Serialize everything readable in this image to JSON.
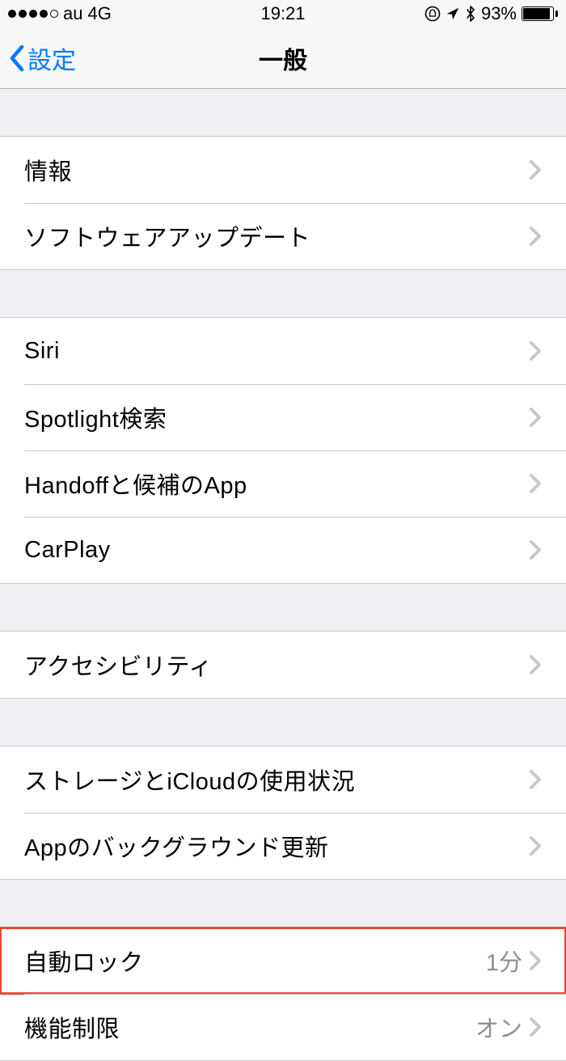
{
  "status": {
    "carrier": "au",
    "network": "4G",
    "time": "19:21",
    "battery_pct": "93%",
    "battery_fill_pct": 93
  },
  "nav": {
    "back_label": "設定",
    "title": "一般"
  },
  "groups": [
    {
      "rows": [
        {
          "label": "情報"
        },
        {
          "label": "ソフトウェアアップデート"
        }
      ]
    },
    {
      "rows": [
        {
          "label": "Siri"
        },
        {
          "label": "Spotlight検索"
        },
        {
          "label": "Handoffと候補のApp"
        },
        {
          "label": "CarPlay"
        }
      ]
    },
    {
      "rows": [
        {
          "label": "アクセシビリティ"
        }
      ]
    },
    {
      "rows": [
        {
          "label": "ストレージとiCloudの使用状況"
        },
        {
          "label": "Appのバックグラウンド更新"
        }
      ]
    },
    {
      "rows": [
        {
          "label": "自動ロック",
          "value": "1分",
          "highlighted": true
        },
        {
          "label": "機能制限",
          "value": "オン"
        }
      ]
    }
  ]
}
